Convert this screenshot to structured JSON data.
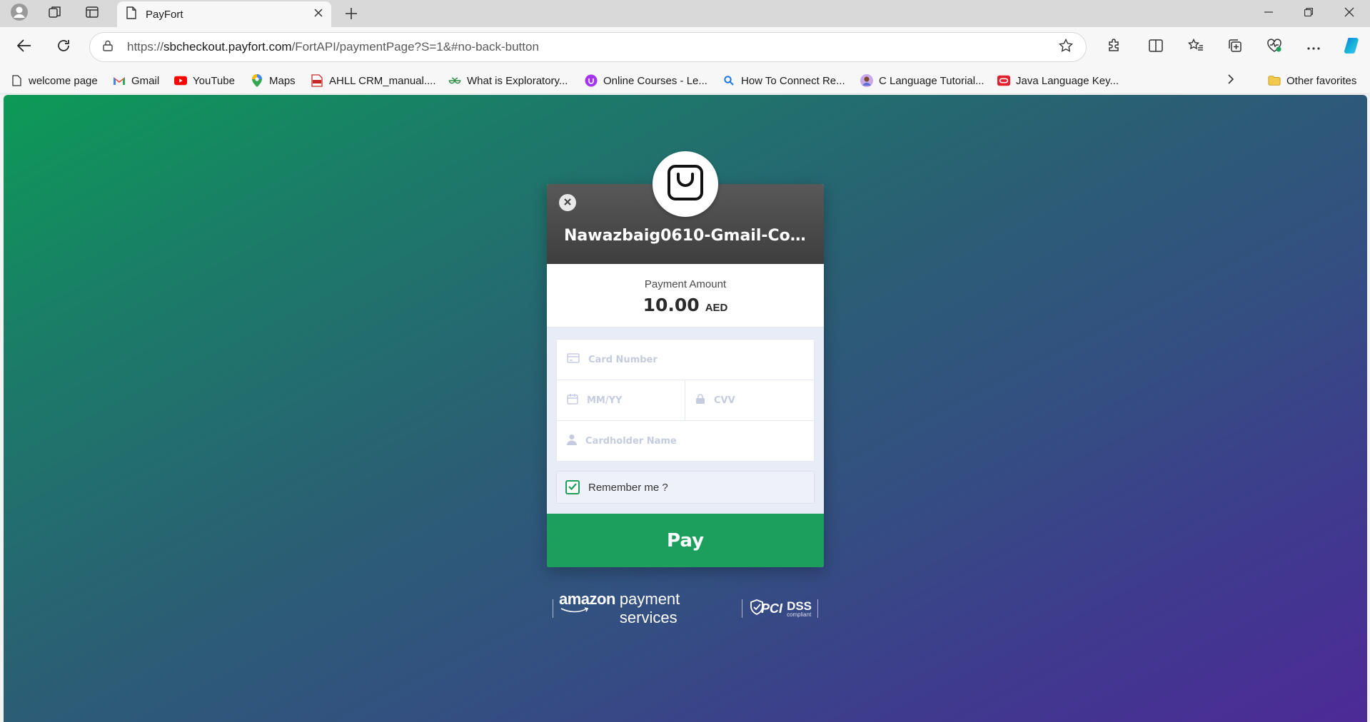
{
  "browser": {
    "tab": {
      "title": "PayFort"
    },
    "address": {
      "url_prefix": "https://",
      "url_host": "sbcheckout.payfort.com",
      "url_path": "/FortAPI/paymentPage?S=1&#no-back-button"
    },
    "bookmarks": [
      {
        "label": "welcome page",
        "icon": "page-icon"
      },
      {
        "label": "Gmail",
        "icon": "gmail-icon"
      },
      {
        "label": "YouTube",
        "icon": "youtube-icon"
      },
      {
        "label": "Maps",
        "icon": "maps-icon"
      },
      {
        "label": "AHLL CRM_manual....",
        "icon": "pdf-icon"
      },
      {
        "label": "What is Exploratory...",
        "icon": "gfg-icon"
      },
      {
        "label": "Online Courses - Le...",
        "icon": "udemy-icon"
      },
      {
        "label": "How To Connect Re...",
        "icon": "search-icon"
      },
      {
        "label": "C Language Tutorial...",
        "icon": "avatar-icon"
      },
      {
        "label": "Java Language Key...",
        "icon": "oracle-icon"
      }
    ],
    "other_favorites": "Other favorites"
  },
  "payment": {
    "merchant_name": "Nawazbaig0610-Gmail-Co...",
    "amount_label": "Payment Amount",
    "amount_value": "10.00",
    "currency": "AED",
    "placeholders": {
      "card_number": "Card Number",
      "expiry": "MM/YY",
      "cvv": "CVV",
      "cardholder": "Cardholder Name"
    },
    "remember_label": "Remember me ?",
    "remember_checked": true,
    "pay_label": "Pay"
  },
  "footer": {
    "brand_bold": "amazon",
    "brand_rest": "payment services",
    "pci": "PCI",
    "dss": "DSS",
    "dss_sub": "compliant"
  },
  "colors": {
    "pay_button": "#1c9e5c",
    "gradient_start": "#0d9a57",
    "gradient_end": "#4d2a97"
  }
}
